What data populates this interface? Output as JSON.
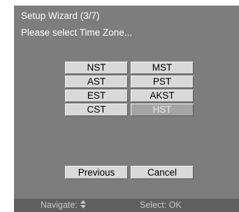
{
  "wizard": {
    "title": "Setup Wizard (3/7)",
    "prompt": "Please select Time Zone..."
  },
  "time_zones": {
    "selected": "HST",
    "options": [
      "NST",
      "MST",
      "AST",
      "PST",
      "EST",
      "AKST",
      "CST",
      "HST"
    ]
  },
  "buttons": {
    "previous": "Previous",
    "cancel": "Cancel"
  },
  "footer": {
    "navigate_label": "Navigate:",
    "navigate_icon": "up-down-arrows-icon",
    "select_label": "Select: OK"
  },
  "colors": {
    "screen_background": "#7d7d7d",
    "button_face": "#d9d9d9",
    "selected_face": "#a5a5a5",
    "footer_bar": "#5f5f5f",
    "text_light": "#ffffff"
  }
}
